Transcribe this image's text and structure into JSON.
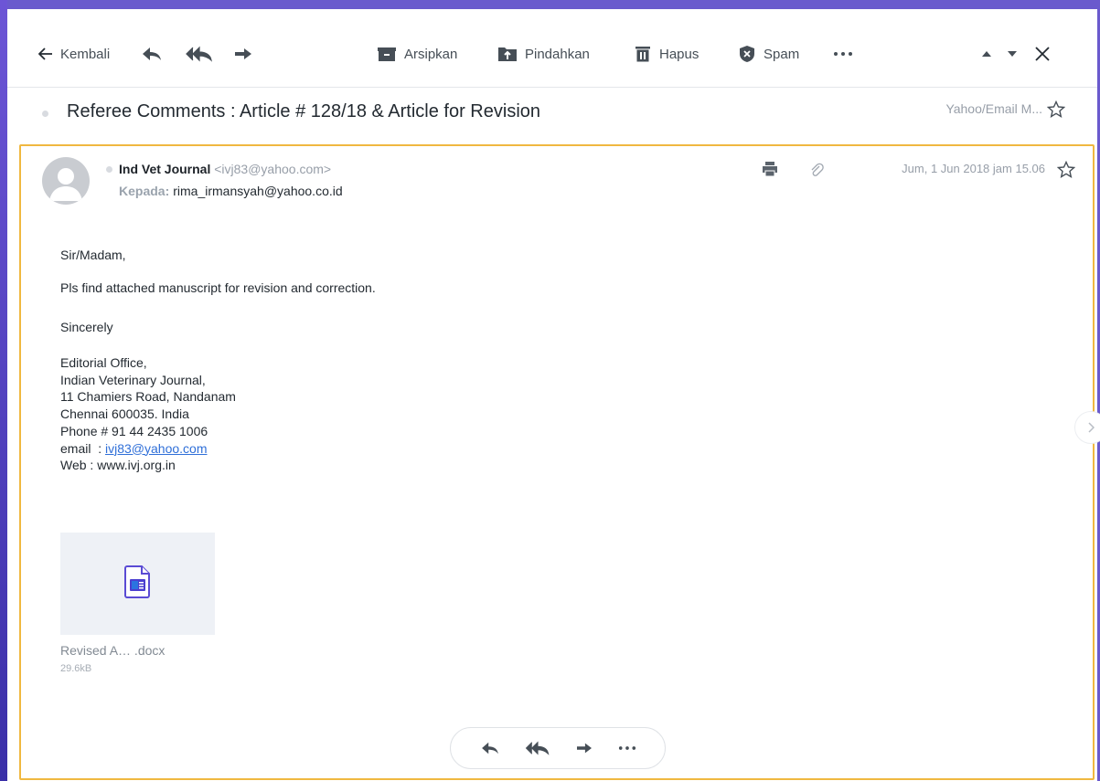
{
  "toolbar": {
    "back_label": "Kembali",
    "archive_label": "Arsipkan",
    "move_label": "Pindahkan",
    "delete_label": "Hapus",
    "spam_label": "Spam"
  },
  "subject": {
    "title": "Referee Comments : Article # 128/18 & Article for Revision",
    "folder": "Yahoo/Email M..."
  },
  "message": {
    "sender_name": "Ind Vet Journal",
    "sender_email": "<ivj83@yahoo.com>",
    "recipient_label": "Kepada:",
    "recipient": "rima_irmansyah@yahoo.co.id",
    "date": "Jum, 1 Jun 2018 jam 15.06",
    "greeting": "Sir/Madam,",
    "line1": "Pls find attached manuscript for revision and correction.",
    "closing": "Sincerely",
    "signature": {
      "l1": "Editorial Office,",
      "l2": "Indian Veterinary Journal,",
      "l3": "11 Chamiers Road, Nandanam",
      "l4": "Chennai 600035. India",
      "l5": "Phone # 91 44 2435 1006",
      "email_prefix": "email  : ",
      "email_link": "ivj83@yahoo.com",
      "web": "Web : www.ivj.org.in"
    }
  },
  "attachment": {
    "name": "Revised A… .docx",
    "size": "29.6kB"
  },
  "colors": {
    "accent": "#6a5acd",
    "card_border": "#f0b840",
    "link": "#2f6fd8"
  }
}
